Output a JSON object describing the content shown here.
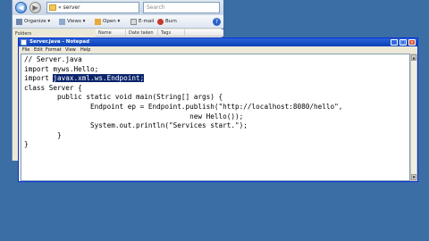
{
  "explorer": {
    "address": "« server",
    "search_placeholder": "Search",
    "toolbar": {
      "organize": "Organize",
      "views": "Views",
      "open": "Open",
      "email": "E-mail",
      "burn": "Burn"
    },
    "left_pane_label": "Folders",
    "columns": [
      "Name",
      "Date taken",
      "Tags"
    ]
  },
  "notepad": {
    "title": "Server.java - Notepad",
    "menu": [
      "File",
      "Edit",
      "Format",
      "View",
      "Help"
    ],
    "code": {
      "line1": "// Server.java",
      "line2": "import myws.Hello;",
      "line3_prefix": "import ",
      "line3_selected": "javax.xml.ws.Endpoint;",
      "line4": "class Server {",
      "line5": "        public static void main(String[] args) {",
      "line6": "                Endpoint ep = Endpoint.publish(\"http://localhost:8080/hello\",",
      "line7": "                                        new Hello());",
      "line8": "                System.out.println(\"Services start.\");",
      "line9": "        }",
      "line10": "}"
    },
    "selection_color": "#0a246a"
  }
}
